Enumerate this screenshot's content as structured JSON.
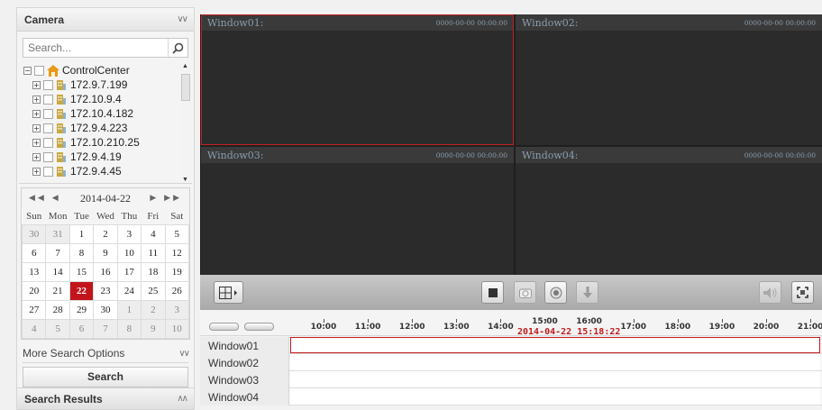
{
  "camera_panel": {
    "title": "Camera",
    "collapse_icon": "double-chevron-down",
    "search_placeholder": "Search...",
    "tree": {
      "root": "ControlCenter",
      "devices": [
        "172.9.7.199",
        "172.10.9.4",
        "172.10.4.182",
        "172.9.4.223",
        "172.10.210.25",
        "172.9.4.19",
        "172.9.4.45"
      ]
    }
  },
  "calendar": {
    "current_date": "2014-04-22",
    "weekdays": [
      "Sun",
      "Mon",
      "Tue",
      "Wed",
      "Thu",
      "Fri",
      "Sat"
    ],
    "weeks": [
      [
        {
          "d": "30",
          "o": true
        },
        {
          "d": "31",
          "o": true
        },
        {
          "d": "1"
        },
        {
          "d": "2"
        },
        {
          "d": "3"
        },
        {
          "d": "4"
        },
        {
          "d": "5"
        }
      ],
      [
        {
          "d": "6"
        },
        {
          "d": "7"
        },
        {
          "d": "8"
        },
        {
          "d": "9"
        },
        {
          "d": "10"
        },
        {
          "d": "11"
        },
        {
          "d": "12"
        }
      ],
      [
        {
          "d": "13"
        },
        {
          "d": "14"
        },
        {
          "d": "15"
        },
        {
          "d": "16"
        },
        {
          "d": "17"
        },
        {
          "d": "18"
        },
        {
          "d": "19"
        }
      ],
      [
        {
          "d": "20"
        },
        {
          "d": "21"
        },
        {
          "d": "22",
          "t": true
        },
        {
          "d": "23"
        },
        {
          "d": "24"
        },
        {
          "d": "25"
        },
        {
          "d": "26"
        }
      ],
      [
        {
          "d": "27"
        },
        {
          "d": "28"
        },
        {
          "d": "29"
        },
        {
          "d": "30"
        },
        {
          "d": "1",
          "o": true
        },
        {
          "d": "2",
          "o": true
        },
        {
          "d": "3",
          "o": true
        }
      ],
      [
        {
          "d": "4",
          "o": true
        },
        {
          "d": "5",
          "o": true
        },
        {
          "d": "6",
          "o": true
        },
        {
          "d": "7",
          "o": true
        },
        {
          "d": "8",
          "o": true
        },
        {
          "d": "9",
          "o": true
        },
        {
          "d": "10",
          "o": true
        }
      ]
    ]
  },
  "more_search_options": "More Search Options",
  "search_button": "Search",
  "search_results": "Search Results",
  "windows": [
    {
      "name": "Window01:",
      "timestamp": "0000-00-00 00:00:00",
      "selected": true
    },
    {
      "name": "Window02:",
      "timestamp": "0000-00-00 00:00:00",
      "selected": false
    },
    {
      "name": "Window03:",
      "timestamp": "0000-00-00 00:00:00",
      "selected": false
    },
    {
      "name": "Window04:",
      "timestamp": "0000-00-00 00:00:00",
      "selected": false
    }
  ],
  "toolbar": {
    "layout_icon": "grid-layout-icon",
    "buttons": [
      "stop-icon",
      "capture-icon",
      "record-icon",
      "download-icon",
      "audio-icon",
      "fullscreen-icon"
    ]
  },
  "timeline": {
    "hours": [
      "10:00",
      "11:00",
      "12:00",
      "13:00",
      "14:00",
      "15:00",
      "16:00",
      "17:00",
      "18:00",
      "19:00",
      "20:00",
      "21:00"
    ],
    "current_time": "2014-04-22 15:18:22",
    "tracks": [
      "Window01",
      "Window02",
      "Window03",
      "Window04"
    ],
    "accent": "#c31a1a"
  }
}
